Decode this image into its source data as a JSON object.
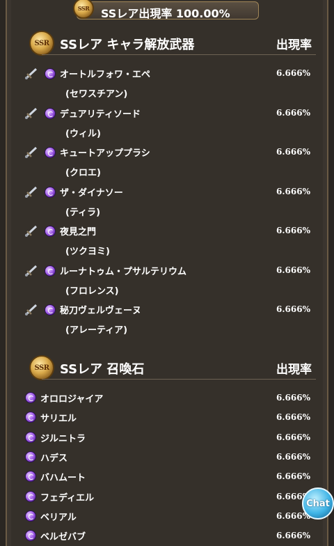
{
  "banner": {
    "label": "SSレア出現率 100.00%",
    "badge": "SSR"
  },
  "weapons_section": {
    "badge": "SSR",
    "title": "SSレア キャラ解放武器",
    "rate_header": "出現率",
    "items": [
      {
        "name": "オートルフォワ・エペ",
        "owner": "(セワスチアン)",
        "rate": "6.666%",
        "icon": "sword-icon"
      },
      {
        "name": "デュアリティソード",
        "owner": "(ウィル)",
        "rate": "6.666%",
        "icon": "sword-icon"
      },
      {
        "name": "キュートアッププラシ",
        "owner": "(クロエ)",
        "rate": "6.666%",
        "icon": "staff-icon"
      },
      {
        "name": "ザ・ダイナソー",
        "owner": "(ティラ)",
        "rate": "6.666%",
        "icon": "axe-icon"
      },
      {
        "name": "夜見之門",
        "owner": "(ツクヨミ)",
        "rate": "6.666%",
        "icon": "spear-icon"
      },
      {
        "name": "ルーナトゥム・プサルテリウム",
        "owner": "(フロレンス)",
        "rate": "6.666%",
        "icon": "harp-icon"
      },
      {
        "name": "秘刀ヴェルヴェーヌ",
        "owner": "(アレーティア)",
        "rate": "6.666%",
        "icon": "katana-icon"
      }
    ]
  },
  "summons_section": {
    "badge": "SSR",
    "title": "SSレア 召喚石",
    "rate_header": "出現率",
    "items": [
      {
        "name": "オロロジャイア",
        "rate": "6.666%"
      },
      {
        "name": "サリエル",
        "rate": "6.666%"
      },
      {
        "name": "ジルニトラ",
        "rate": "6.666%"
      },
      {
        "name": "ハデス",
        "rate": "6.666%"
      },
      {
        "name": "バハムート",
        "rate": "6.666%"
      },
      {
        "name": "フェディエル",
        "rate": "6.666%"
      },
      {
        "name": "ベリアル",
        "rate": "6.666%"
      },
      {
        "name": "ベルゼバブ",
        "rate": "6.666%"
      }
    ]
  },
  "chat_button": {
    "label": "Chat"
  },
  "colors": {
    "background": "#35302a",
    "border": "#6a5a45",
    "orb": "#a05ce8",
    "badge_gold": "#d9a94a"
  }
}
